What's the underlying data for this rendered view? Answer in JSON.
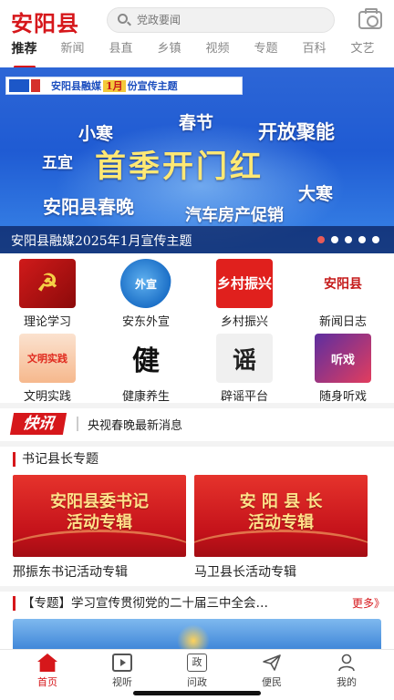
{
  "header": {
    "logo": "安阳县",
    "search_placeholder": "党政要闻"
  },
  "tabs": [
    {
      "label": "推荐",
      "active": true
    },
    {
      "label": "新闻"
    },
    {
      "label": "县直"
    },
    {
      "label": "乡镇"
    },
    {
      "label": "视频"
    },
    {
      "label": "专题"
    },
    {
      "label": "百科"
    },
    {
      "label": "文艺"
    }
  ],
  "banner": {
    "strip_prefix": "安阳县融媒",
    "strip_month": "1月",
    "strip_suffix": "份宣传主题",
    "words": {
      "xiaohan": "小寒",
      "chunjie": "春节",
      "kaifang": "开放聚能",
      "wuyi": "五宜",
      "shouji": "首季开门红",
      "dahan": "大寒",
      "chunwan": "安阳县春晚",
      "qiche": "汽车房产促销"
    },
    "caption": "安阳县融媒2025年1月宣传主题",
    "slides": 5,
    "active_slide": 1
  },
  "grid": [
    {
      "label": "理论学习",
      "icon_text": "☭"
    },
    {
      "label": "安东外宣",
      "icon_text": "外宣"
    },
    {
      "label": "乡村振兴",
      "icon_text": "乡村振兴"
    },
    {
      "label": "新闻日志",
      "icon_text": "安阳县"
    },
    {
      "label": "文明实践",
      "icon_text": "文明实践"
    },
    {
      "label": "健康养生",
      "icon_text": "健"
    },
    {
      "label": "辟谣平台",
      "icon_text": "谣"
    },
    {
      "label": "随身听戏",
      "icon_text": "听戏"
    }
  ],
  "kuaixun": {
    "badge": "快讯",
    "text": "央视春晚最新消息"
  },
  "section": {
    "title": "书记县长专题",
    "cards": [
      {
        "title_line1": "安阳县委书记",
        "title_line2": "活动专辑",
        "label": "邢振东书记活动专辑"
      },
      {
        "title_line1": "安 阳 县 长",
        "title_line2": "活动专辑",
        "label": "马卫县长活动专辑"
      }
    ]
  },
  "topic": {
    "text": "【专题】学习宣传贯彻党的二十届三中全会…",
    "more": "更多》"
  },
  "bottom_nav": [
    {
      "label": "首页",
      "icon": "home-icon",
      "active": true
    },
    {
      "label": "视听",
      "icon": "tv-icon"
    },
    {
      "label": "问政",
      "icon": "wenzheng-icon",
      "icon_text": "政"
    },
    {
      "label": "便民",
      "icon": "paper-plane-icon"
    },
    {
      "label": "我的",
      "icon": "user-icon"
    }
  ],
  "colors": {
    "brand_red": "#d6171b",
    "banner_blue": "#1f5bd3",
    "highlight_yellow": "#ffe874"
  }
}
